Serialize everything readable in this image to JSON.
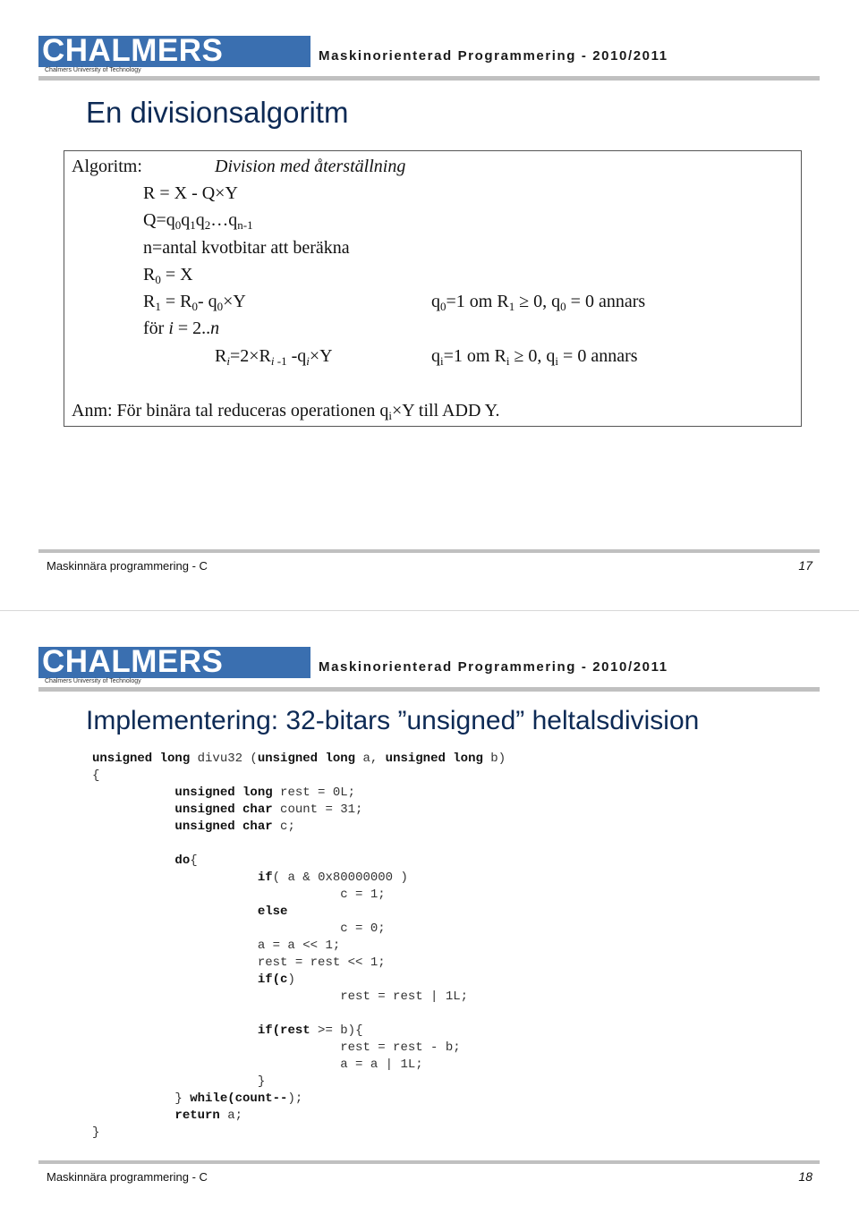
{
  "header": {
    "logo_text": "CHALMERS",
    "logo_subtitle": "Chalmers University of Technology",
    "course_title": "Maskinorienterad Programmering - 2010/2011",
    "brand_color": "#3a6fb0"
  },
  "slide1": {
    "title": "En divisionsalgoritm",
    "algorithm": {
      "label": "Algoritm:",
      "name": "Division med återställning",
      "line_r": "R = X - Q×Y",
      "line_q": "Q=q",
      "line_n": "n=antal kvotbitar att beräkna",
      "line_r0": "R",
      "line_r1": "R",
      "line_for": "för",
      "cond_q0": "=1 om R",
      "cond_q0_tail": "≥  0, q",
      "cond_q0_end": "= 0 annars",
      "cond_qi": "=1 om R",
      "cond_qi_tail": "≥  0, q",
      "cond_qi_end": "= 0 annars",
      "note": "Anm: För binära tal reduceras operationen q",
      "note_tail": "×Y till ADD Y."
    },
    "footer": {
      "text": "Maskinnära programmering - C",
      "page": "17"
    }
  },
  "slide2": {
    "title": "Implementering: 32-bitars ”unsigned” heltalsdivision",
    "footer": {
      "text": "Maskinnära programmering - C",
      "page": "18"
    }
  }
}
